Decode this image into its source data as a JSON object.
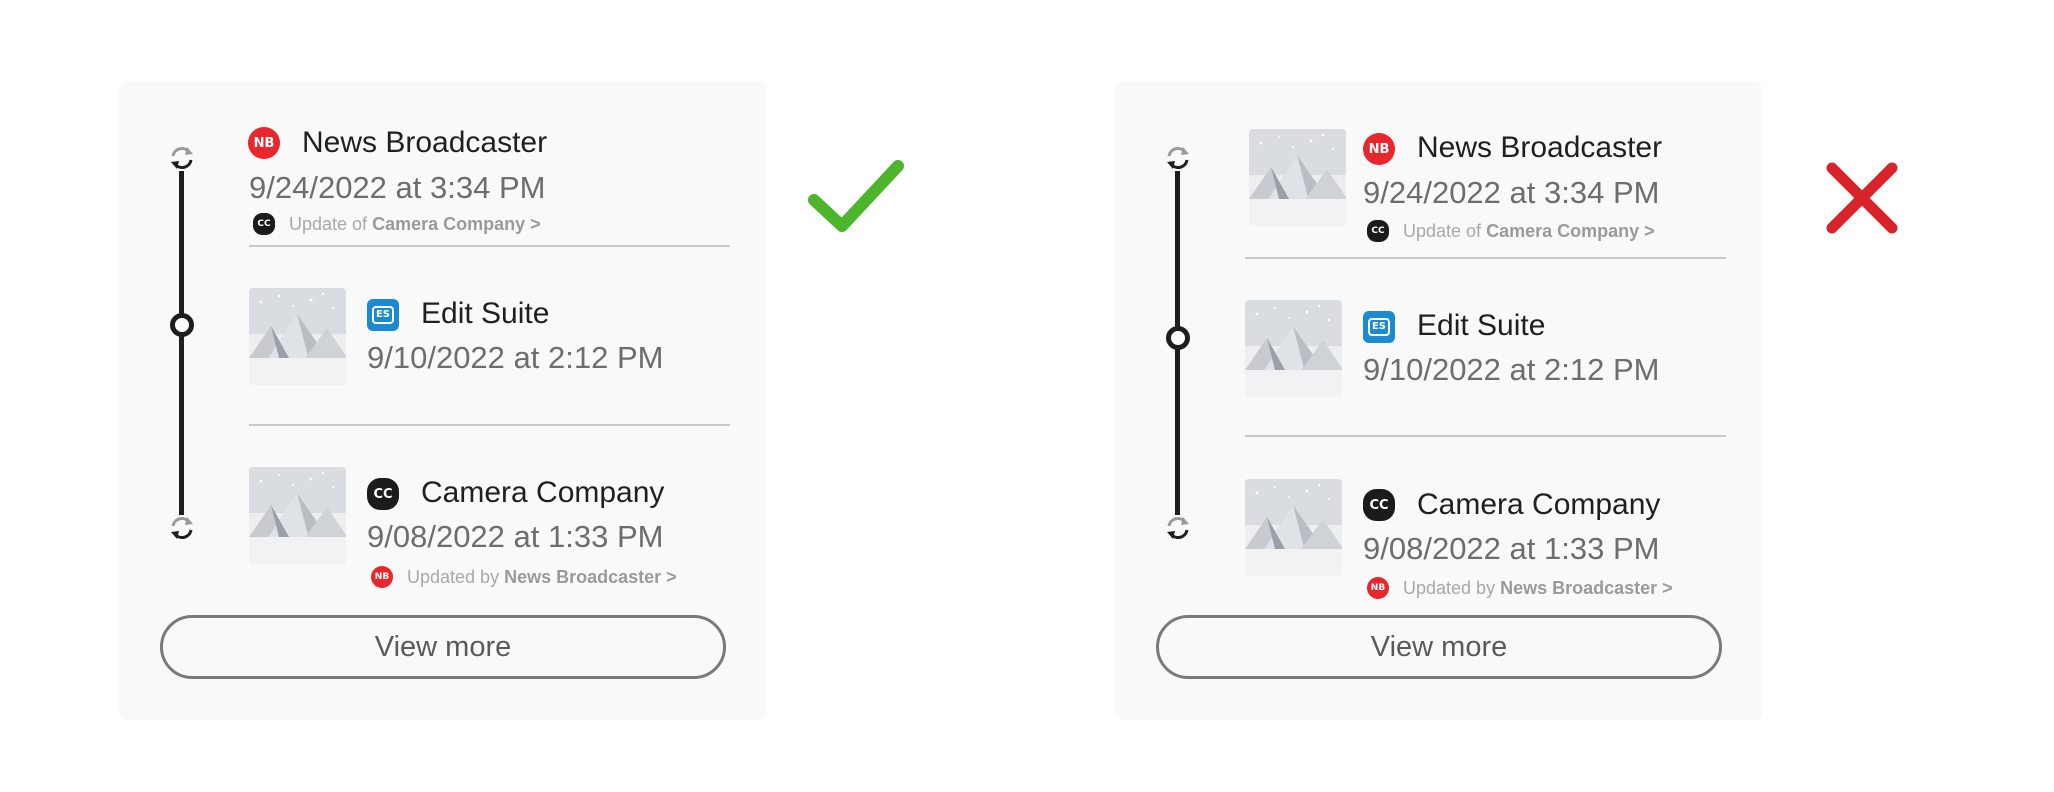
{
  "panels": {
    "good": {
      "items": [
        {
          "source_badge": "NB",
          "name": "News Broadcaster",
          "date": "9/24/2022 at 3:34 PM",
          "sub_badge": "CC",
          "sub_prefix": "Update of",
          "sub_link": "Camera Company >"
        },
        {
          "source_badge": "ES",
          "name": "Edit Suite",
          "date": "9/10/2022 at 2:12 PM"
        },
        {
          "source_badge": "CC",
          "name": "Camera Company",
          "date": "9/08/2022 at 1:33 PM",
          "sub_badge": "NB",
          "sub_prefix": "Updated by",
          "sub_link": "News Broadcaster >"
        }
      ],
      "view_more": "View more"
    },
    "bad": {
      "items": [
        {
          "source_badge": "NB",
          "name": "News Broadcaster",
          "date": "9/24/2022 at 3:34 PM",
          "sub_badge": "CC",
          "sub_prefix": "Update of",
          "sub_link": "Camera Company >"
        },
        {
          "source_badge": "ES",
          "name": "Edit Suite",
          "date": "9/10/2022 at 2:12 PM"
        },
        {
          "source_badge": "CC",
          "name": "Camera Company",
          "date": "9/08/2022 at 1:33 PM",
          "sub_badge": "NB",
          "sub_prefix": "Updated by",
          "sub_link": "News Broadcaster >"
        }
      ],
      "view_more": "View more"
    }
  },
  "icons": {
    "timeline_top": "sync-icon",
    "timeline_bottom": "sync-icon",
    "good_mark": "check-icon",
    "bad_mark": "cross-icon"
  },
  "colors": {
    "check": "#4cb52b",
    "cross": "#d9232a",
    "nb_badge": "#e8262b",
    "es_badge": "#1b8ad1",
    "cc_badge": "#1b1b1b"
  }
}
